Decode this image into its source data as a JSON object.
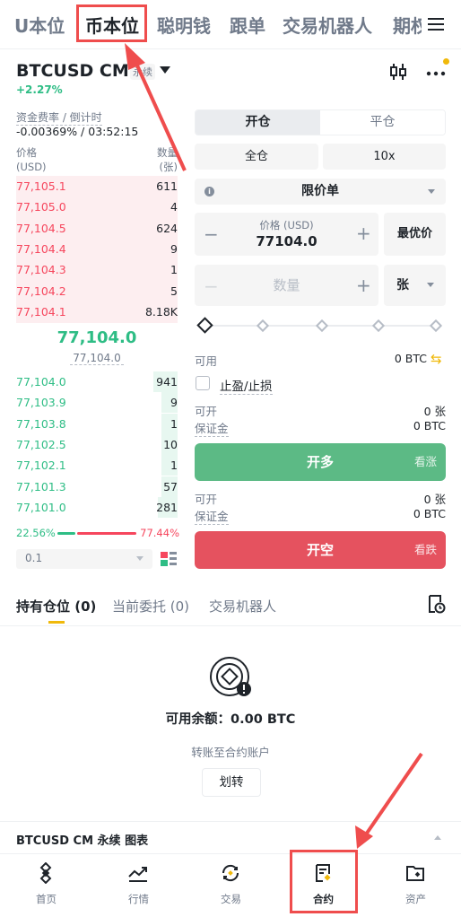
{
  "top_tabs": [
    "U本位",
    "币本位",
    "聪明钱",
    "跟单",
    "交易机器人",
    "期权"
  ],
  "symbol": {
    "name": "BTCUSD CM",
    "badge": "永续",
    "change": "+2.27%"
  },
  "funding": {
    "label": "资金费率 / 倒计时",
    "value": "-0.00369% / 03:52:15"
  },
  "orderbook": {
    "price_header": [
      "价格",
      "(USD)"
    ],
    "qty_header": [
      "数量",
      "(张)"
    ],
    "asks": [
      {
        "price": "77,105.1",
        "qty": "611"
      },
      {
        "price": "77,105.0",
        "qty": "4"
      },
      {
        "price": "77,104.5",
        "qty": "624"
      },
      {
        "price": "77,104.4",
        "qty": "9"
      },
      {
        "price": "77,104.3",
        "qty": "1"
      },
      {
        "price": "77,104.2",
        "qty": "5"
      },
      {
        "price": "77,104.1",
        "qty": "8.18K"
      }
    ],
    "last_price": "77,104.0",
    "mark_price": "77,104.0",
    "bids": [
      {
        "price": "77,104.0",
        "qty": "941",
        "depth": 0.15
      },
      {
        "price": "77,103.9",
        "qty": "9",
        "depth": 0.1
      },
      {
        "price": "77,103.8",
        "qty": "1",
        "depth": 0.1
      },
      {
        "price": "77,102.5",
        "qty": "10",
        "depth": 0.1
      },
      {
        "price": "77,102.1",
        "qty": "1",
        "depth": 0.1
      },
      {
        "price": "77,101.3",
        "qty": "57",
        "depth": 0.1
      },
      {
        "price": "77,101.0",
        "qty": "281",
        "depth": 0.12
      }
    ],
    "buy_ratio": "22.56%",
    "sell_ratio": "77.44%",
    "depth_step": "0.1"
  },
  "form": {
    "open_tab": "开仓",
    "close_tab": "平仓",
    "margin_mode": "全仓",
    "leverage": "10x",
    "order_type": "限价单",
    "price_label": "价格 (USD)",
    "price_value": "77104.0",
    "bbo_label": "最优价",
    "qty_placeholder": "数量",
    "unit": "张",
    "available_label": "可用",
    "available_value": "0 BTC",
    "tpsl_label": "止盈/止损",
    "long": {
      "max_open_label": "可开",
      "max_open_value": "0 张",
      "margin_label": "保证金",
      "margin_value": "0 BTC",
      "button": "开多",
      "sub": "看涨"
    },
    "short": {
      "max_open_label": "可开",
      "max_open_value": "0 张",
      "margin_label": "保证金",
      "margin_value": "0 BTC",
      "button": "开空",
      "sub": "看跌"
    }
  },
  "positions": {
    "tabs": [
      "持有仓位 (0)",
      "当前委托 (0)",
      "交易机器人"
    ],
    "balance_text": "可用余额：0.00 BTC",
    "transfer_tip": "转账至合约账户",
    "transfer_button": "划转"
  },
  "chart_bar": "BTCUSD CM 永续 图表",
  "bottom_nav": [
    "首页",
    "行情",
    "交易",
    "合约",
    "资产"
  ],
  "colors": {
    "green": "#2ebd85",
    "red": "#f6465d",
    "accent": "#f0b90b",
    "annotation": "#ef4d4d"
  }
}
